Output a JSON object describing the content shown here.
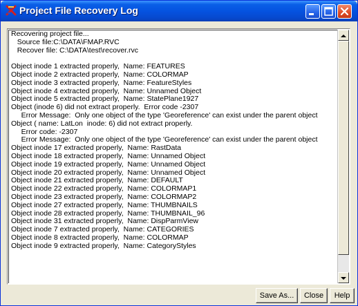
{
  "window": {
    "title": "Project File Recovery Log",
    "title_bar_color": "#0553e0",
    "close_color": "#de4a24"
  },
  "log": {
    "lines": [
      "Recovering project file...",
      "   Source file:C:\\DATA\\FMAP.RVC",
      "   Recover file: C:\\DATA\\test\\recover.rvc",
      "",
      "Object inode 1 extracted properly,  Name: FEATURES",
      "Object inode 2 extracted properly,  Name: COLORMAP",
      "Object inode 3 extracted properly,  Name: FeatureStyles",
      "Object inode 4 extracted properly,  Name: Unnamed Object",
      "Object inode 5 extracted properly,  Name: StatePlane1927",
      "Object (inode 6) did not extract properly.  Error code -2307",
      "     Error Message:  Only one object of the type 'Georeference' can exist under the parent object",
      "Object ( name: LatLon  inode: 6) did not extract properly.",
      "     Error code: -2307",
      "     Error Message:  Only one object of the type 'Georeference' can exist under the parent object",
      "Object inode 17 extracted properly,  Name: RastData",
      "Object inode 18 extracted properly,  Name: Unnamed Object",
      "Object inode 19 extracted properly,  Name: Unnamed Object",
      "Object inode 20 extracted properly,  Name: Unnamed Object",
      "Object inode 21 extracted properly,  Name: DEFAULT",
      "Object inode 22 extracted properly,  Name: COLORMAP1",
      "Object inode 23 extracted properly,  Name: COLORMAP2",
      "Object inode 27 extracted properly,  Name: THUMBNAILS",
      "Object inode 28 extracted properly,  Name: THUMBNAIL_96",
      "Object inode 31 extracted properly,  Name: DispParmView",
      "Object inode 7 extracted properly,  Name: CATEGORIES",
      "Object inode 8 extracted properly,  Name: COLORMAP",
      "Object inode 9 extracted properly,  Name: CategoryStyles"
    ]
  },
  "buttons": {
    "save_as": "Save As...",
    "close": "Close",
    "help": "Help"
  }
}
